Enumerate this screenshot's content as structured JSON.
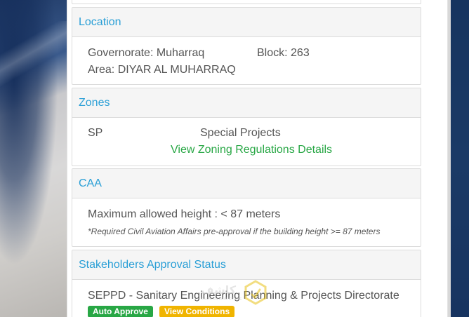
{
  "location": {
    "title": "Location",
    "governorate": "Governorate: Muharraq",
    "block": "Block: 263",
    "area": "Area: DIYAR AL MUHARRAQ"
  },
  "zones": {
    "title": "Zones",
    "code": "SP",
    "name": "Special Projects",
    "link_label": "View Zoning Regulations Details"
  },
  "caa": {
    "title": "CAA",
    "max_height": "Maximum allowed height : < 87 meters",
    "note": "*Required Civil Aviation Affairs pre-approval if the building height >= 87 meters"
  },
  "stakeholders": {
    "title": "Stakeholders Approval Status",
    "entry": "SEPPD - Sanitary Engineering Planning & Projects Directorate",
    "badge_auto": "Auto Approve",
    "badge_conditions": "View Conditions"
  },
  "watermark": {
    "text": "كاشف",
    "sub": "CASHFUN REAL ESTATE"
  },
  "colors": {
    "header_text": "#2a9fd6",
    "link": "#28a745",
    "badge_green": "#28a745",
    "badge_yellow": "#f0b400"
  }
}
